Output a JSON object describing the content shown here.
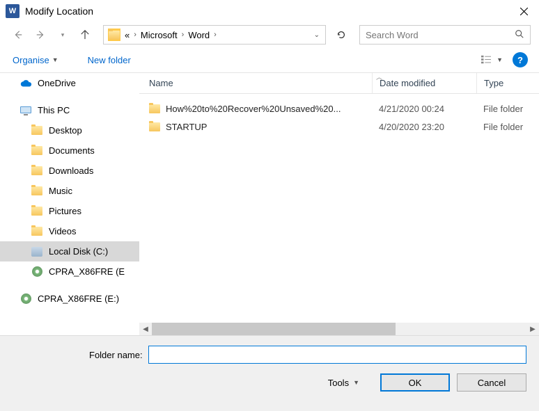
{
  "title": "Modify Location",
  "breadcrumb": {
    "part1": "«",
    "part2": "Microsoft",
    "part3": "Word"
  },
  "search_placeholder": "Search Word",
  "toolbar": {
    "organise": "Organise",
    "newfolder": "New folder"
  },
  "columns": {
    "name": "Name",
    "date": "Date modified",
    "type": "Type"
  },
  "tree": {
    "onedrive": "OneDrive",
    "thispc": "This PC",
    "desktop": "Desktop",
    "documents": "Documents",
    "downloads": "Downloads",
    "music": "Music",
    "pictures": "Pictures",
    "videos": "Videos",
    "localdisk": "Local Disk (C:)",
    "cpra1": "CPRA_X86FRE (E",
    "cpra2": "CPRA_X86FRE (E:)"
  },
  "files": [
    {
      "name": "How%20to%20Recover%20Unsaved%20...",
      "date": "4/21/2020 00:24",
      "type": "File folder"
    },
    {
      "name": "STARTUP",
      "date": "4/20/2020 23:20",
      "type": "File folder"
    }
  ],
  "bottom": {
    "folder_label": "Folder name:",
    "folder_value": "",
    "tools": "Tools",
    "ok": "OK",
    "cancel": "Cancel"
  }
}
